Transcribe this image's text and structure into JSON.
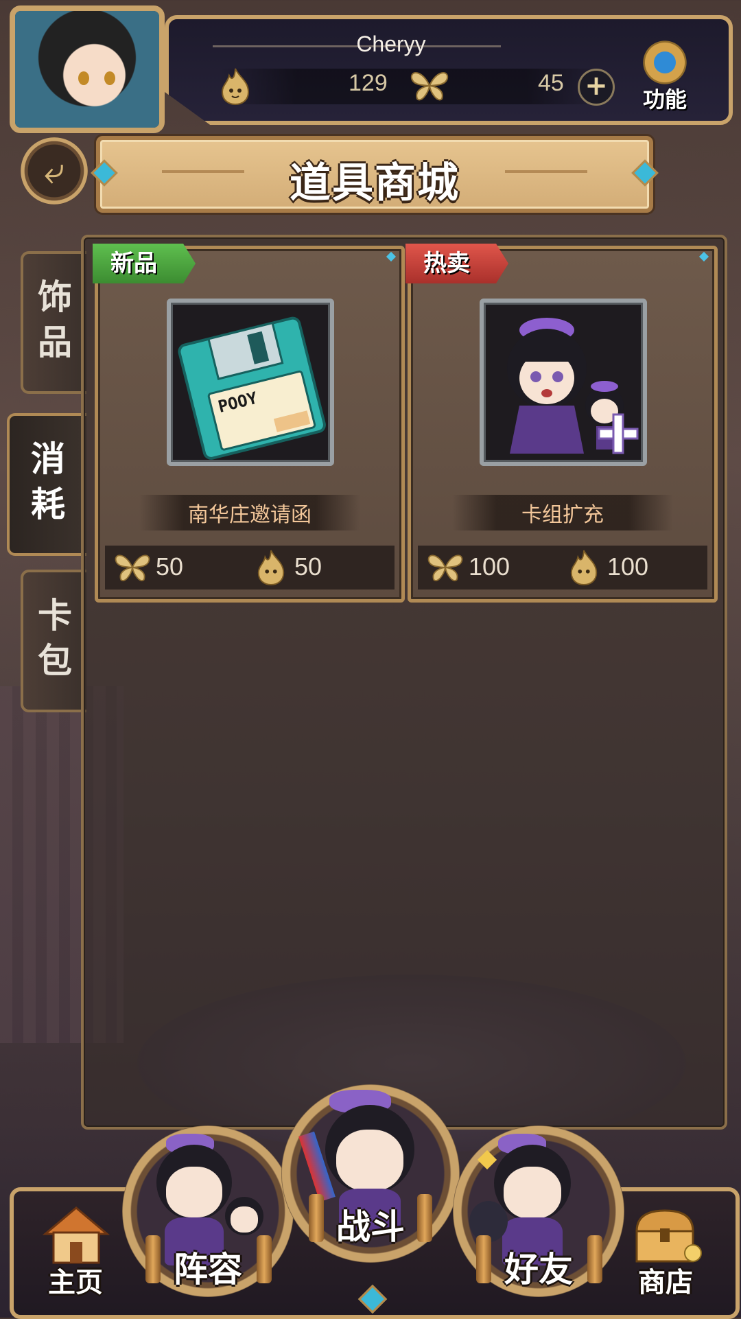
{
  "player": {
    "name": "Cheryy",
    "flame_currency": "129",
    "butterfly_currency": "45"
  },
  "header": {
    "function_label": "功能",
    "page_title": "道具商城"
  },
  "side_tabs": [
    {
      "label": "饰\n品",
      "active": false
    },
    {
      "label": "消\n耗",
      "active": true
    },
    {
      "label": "卡\n包",
      "active": false
    }
  ],
  "items": [
    {
      "tag": "新品",
      "tag_color": "#4aa63d",
      "name": "南华庄邀请函",
      "butterfly_price": "50",
      "flame_price": "50",
      "icon": "floppy-disk-invitation"
    },
    {
      "tag": "热卖",
      "tag_color": "#c9403a",
      "name": "卡组扩充",
      "butterfly_price": "100",
      "flame_price": "100",
      "icon": "deck-expand-chibi"
    }
  ],
  "floppy_label": "POOY",
  "bottom_nav": {
    "home": "主页",
    "lineup": "阵容",
    "battle": "战斗",
    "friends": "好友",
    "shop": "商店"
  }
}
